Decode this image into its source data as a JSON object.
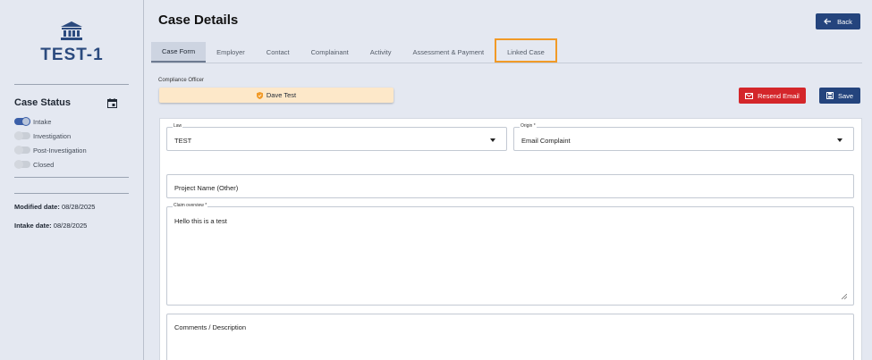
{
  "sidebar": {
    "case_id": "TEST-1",
    "case_status_title": "Case Status",
    "statuses": [
      {
        "label": "Intake",
        "on": true
      },
      {
        "label": "Investigation",
        "on": false
      },
      {
        "label": "Post-Investigation",
        "on": false
      },
      {
        "label": "Closed",
        "on": false
      }
    ],
    "modified_label": "Modified date:",
    "modified_value": "08/28/2025",
    "intake_label": "Intake date:",
    "intake_value": "08/28/2025"
  },
  "header": {
    "title": "Case Details",
    "back_label": "Back"
  },
  "tabs": [
    {
      "label": "Case Form",
      "active": true
    },
    {
      "label": "Employer",
      "active": false
    },
    {
      "label": "Contact",
      "active": false
    },
    {
      "label": "Complainant",
      "active": false
    },
    {
      "label": "Activity",
      "active": false
    },
    {
      "label": "Assessment & Payment",
      "active": false
    },
    {
      "label": "Linked Case",
      "active": false
    }
  ],
  "compliance": {
    "label": "Compliance Officer",
    "officer": "Dave Test"
  },
  "actions": {
    "resend_email": "Resend Email",
    "save": "Save"
  },
  "form": {
    "law_label": "Law",
    "law_value": "TEST",
    "origin_label": "Origin *",
    "origin_value": "Email Complaint",
    "project_name_placeholder": "Project Name (Other)",
    "claim_label": "Claim overview *",
    "claim_value": "Hello this is a test",
    "comments_placeholder": "Comments / Description"
  },
  "colors": {
    "primary": "#24447d",
    "danger": "#d4262a",
    "highlight": "#f19a27",
    "officer_badge": "#fde8c9"
  }
}
